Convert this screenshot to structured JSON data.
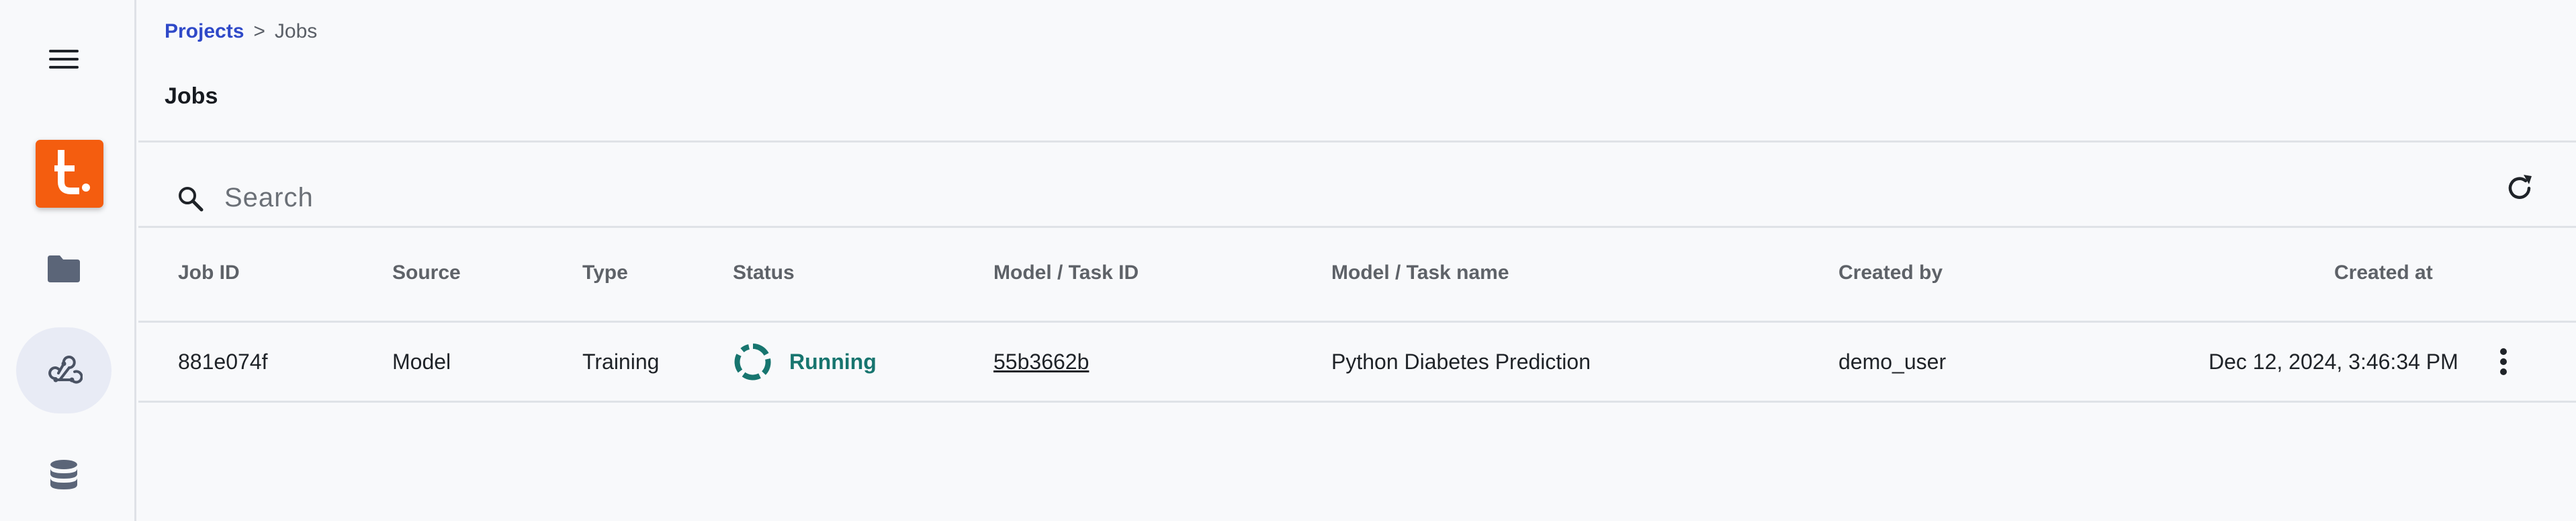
{
  "sidebar": {
    "items": [
      {
        "name": "menu",
        "icon": "hamburger-menu-icon"
      },
      {
        "name": "logo",
        "icon": "app-logo",
        "text": "t."
      },
      {
        "name": "projects",
        "icon": "folder-icon"
      },
      {
        "name": "models",
        "icon": "webhook-icon",
        "active": true
      },
      {
        "name": "datasets",
        "icon": "database-icon"
      }
    ]
  },
  "breadcrumb": {
    "parent": "Projects",
    "separator": ">",
    "current": "Jobs"
  },
  "page_title": "Jobs",
  "search": {
    "placeholder": "Search",
    "value": ""
  },
  "table": {
    "headers": [
      "Job ID",
      "Source",
      "Type",
      "Status",
      "Model / Task ID",
      "Model / Task name",
      "Created by",
      "Created at"
    ],
    "rows": [
      {
        "job_id": "881e074f",
        "source": "Model",
        "type": "Training",
        "status": "Running",
        "task_id": "55b3662b",
        "task_name": "Python Diabetes Prediction",
        "created_by": "demo_user",
        "created_at": "Dec 12, 2024, 3:46:34 PM"
      }
    ]
  },
  "colors": {
    "accent": "#2f49c8",
    "logo": "#f45d0f",
    "status_running": "#17756f",
    "active_nav": "#e8ebf5"
  }
}
